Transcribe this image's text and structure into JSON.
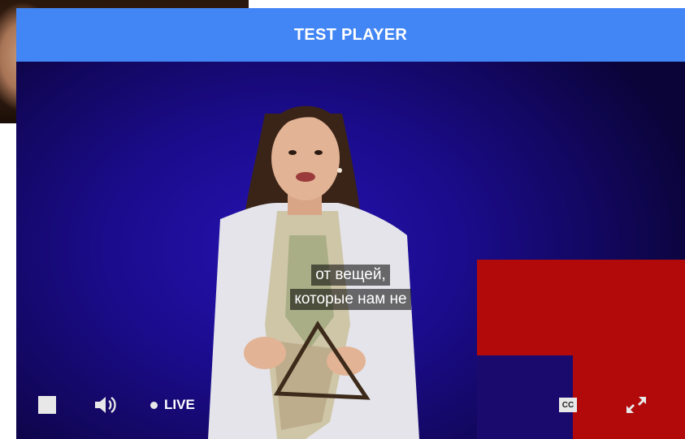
{
  "player": {
    "title": "TEST PLAYER"
  },
  "subtitles": {
    "lines": [
      "от вещей,",
      "которые нам не"
    ]
  },
  "controls": {
    "stop_icon": "stop-icon",
    "volume_icon": "volume-icon",
    "live_label": "LIVE",
    "cc_label": "CC",
    "fullscreen_icon": "fullscreen-icon"
  },
  "colors": {
    "title_bar": "#4285f4",
    "stage_background": "#1b0c8e",
    "stage_red": "#b20a0a"
  }
}
